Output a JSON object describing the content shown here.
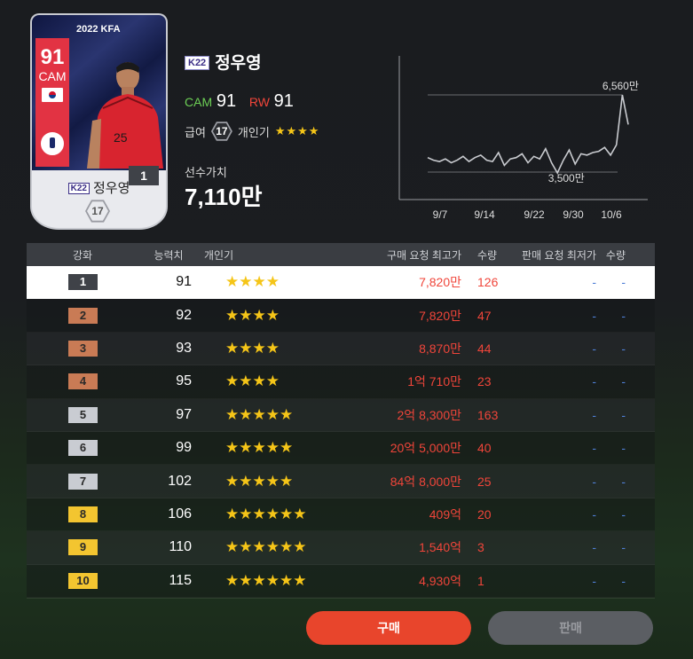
{
  "card": {
    "season": "2022 KFA",
    "ovr": "91",
    "position": "CAM",
    "name": "정우영",
    "league_tag": "K22",
    "grade": "1",
    "pay": "17"
  },
  "player": {
    "league_tag": "K22",
    "name": "정우영",
    "pos1": "CAM",
    "pos1_val": "91",
    "pos2": "RW",
    "pos2_val": "91",
    "pay_label": "급여",
    "pay_value": "17",
    "pop_label": "개인기",
    "pop_stars": "★★★★",
    "value_label": "선수가치",
    "value": "7,110만"
  },
  "chart_data": {
    "type": "line",
    "x_ticks": [
      "9/7",
      "9/14",
      "9/22",
      "9/30",
      "10/6"
    ],
    "annotations": {
      "max_label": "6,560만",
      "min_label": "3,500만"
    },
    "max_value": 6560,
    "min_value": 3500,
    "values": [
      4100,
      4000,
      3950,
      4050,
      3900,
      4000,
      4150,
      3950,
      4100,
      4200,
      4000,
      3950,
      4300,
      3800,
      4050,
      4100,
      4250,
      3900,
      4150,
      4050,
      4450,
      3900,
      3500,
      4000,
      4400,
      3850,
      4250,
      4200,
      4300,
      4350,
      4500,
      4200,
      4600,
      6560,
      5400
    ]
  },
  "table": {
    "headers": {
      "grade": "강화",
      "ovr": "능력치",
      "pop": "개인기",
      "buy": "구매 요청 최고가",
      "buy_qty": "수량",
      "sell": "판매 요청 최저가",
      "sell_qty": "수량"
    },
    "rows": [
      {
        "grade": "1",
        "ovr": "91",
        "stars": "★★★★",
        "buy": "7,820만",
        "buy_qty": "126",
        "sell": "-",
        "sell_qty": "-"
      },
      {
        "grade": "2",
        "ovr": "92",
        "stars": "★★★★",
        "buy": "7,820만",
        "buy_qty": "47",
        "sell": "-",
        "sell_qty": "-"
      },
      {
        "grade": "3",
        "ovr": "93",
        "stars": "★★★★",
        "buy": "8,870만",
        "buy_qty": "44",
        "sell": "-",
        "sell_qty": "-"
      },
      {
        "grade": "4",
        "ovr": "95",
        "stars": "★★★★",
        "buy": "1억 710만",
        "buy_qty": "23",
        "sell": "-",
        "sell_qty": "-"
      },
      {
        "grade": "5",
        "ovr": "97",
        "stars": "★★★★★",
        "buy": "2억 8,300만",
        "buy_qty": "163",
        "sell": "-",
        "sell_qty": "-"
      },
      {
        "grade": "6",
        "ovr": "99",
        "stars": "★★★★★",
        "buy": "20억 5,000만",
        "buy_qty": "40",
        "sell": "-",
        "sell_qty": "-"
      },
      {
        "grade": "7",
        "ovr": "102",
        "stars": "★★★★★",
        "buy": "84억 8,000만",
        "buy_qty": "25",
        "sell": "-",
        "sell_qty": "-"
      },
      {
        "grade": "8",
        "ovr": "106",
        "stars": "★★★★★★",
        "buy": "409억",
        "buy_qty": "20",
        "sell": "-",
        "sell_qty": "-"
      },
      {
        "grade": "9",
        "ovr": "110",
        "stars": "★★★★★★",
        "buy": "1,540억",
        "buy_qty": "3",
        "sell": "-",
        "sell_qty": "-"
      },
      {
        "grade": "10",
        "ovr": "115",
        "stars": "★★★★★★",
        "buy": "4,930억",
        "buy_qty": "1",
        "sell": "-",
        "sell_qty": "-"
      }
    ]
  },
  "grade_colors": {
    "1": "#3f4248",
    "2": "#c97b55",
    "3": "#c97b55",
    "4": "#c97b55",
    "5": "#c9ccd2",
    "6": "#c9ccd2",
    "7": "#c9ccd2",
    "8": "#f3c530",
    "9": "#f3c530",
    "10": "#f3c530"
  },
  "buttons": {
    "buy": "구매",
    "sell": "판매"
  }
}
